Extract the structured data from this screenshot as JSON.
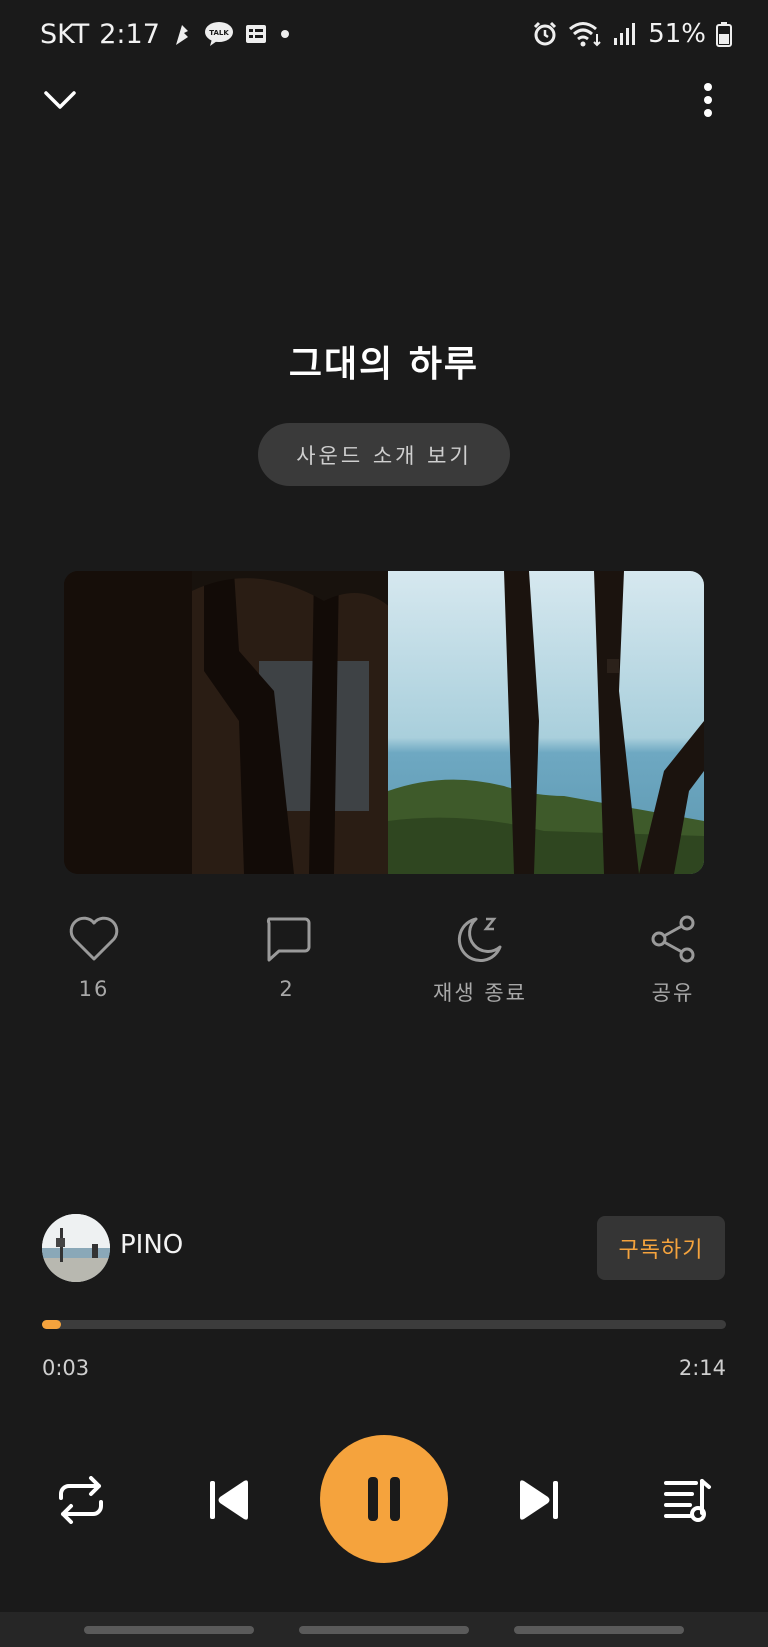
{
  "status_bar": {
    "carrier": "SKT",
    "time": "2:17",
    "talk_label": "TALK",
    "battery": "51%"
  },
  "track": {
    "title": "그대의 하루",
    "intro_button": "사운드 소개 보기"
  },
  "actions": {
    "like_count": "16",
    "comment_count": "2",
    "sleep_label": "재생 종료",
    "share_label": "공유"
  },
  "artist": {
    "name": "PINO",
    "subscribe_label": "구독하기"
  },
  "playback": {
    "current_time": "0:03",
    "total_time": "2:14",
    "progress": 0.028
  },
  "colors": {
    "background": "#1a1a1a",
    "accent": "#f5a33d",
    "button_bg": "#3a3a3a",
    "muted_text": "#a8a8a8"
  }
}
